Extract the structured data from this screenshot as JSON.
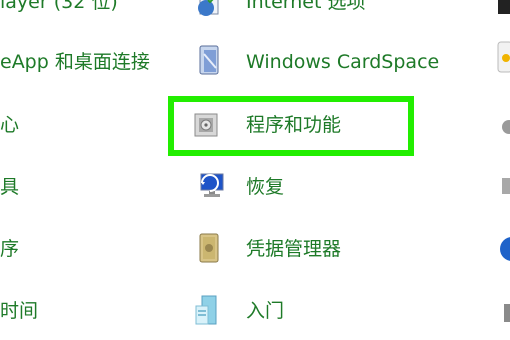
{
  "left_column": [
    {
      "label": "layer (32 位)"
    },
    {
      "label": "eApp 和桌面连接"
    },
    {
      "label": "心"
    },
    {
      "label": "具"
    },
    {
      "label": "序"
    },
    {
      "label": "时间"
    }
  ],
  "middle_column": [
    {
      "label": "Internet 选项",
      "icon": "globe-checklist-icon"
    },
    {
      "label": "Windows CardSpace",
      "icon": "cardspace-icon"
    },
    {
      "label": "程序和功能",
      "icon": "programs-features-icon"
    },
    {
      "label": "恢复",
      "icon": "recovery-monitor-icon"
    },
    {
      "label": "凭据管理器",
      "icon": "safe-vault-icon"
    },
    {
      "label": "入门",
      "icon": "getting-started-icon"
    }
  ],
  "highlight_color": "#22ee00",
  "link_color": "#1e7a28"
}
